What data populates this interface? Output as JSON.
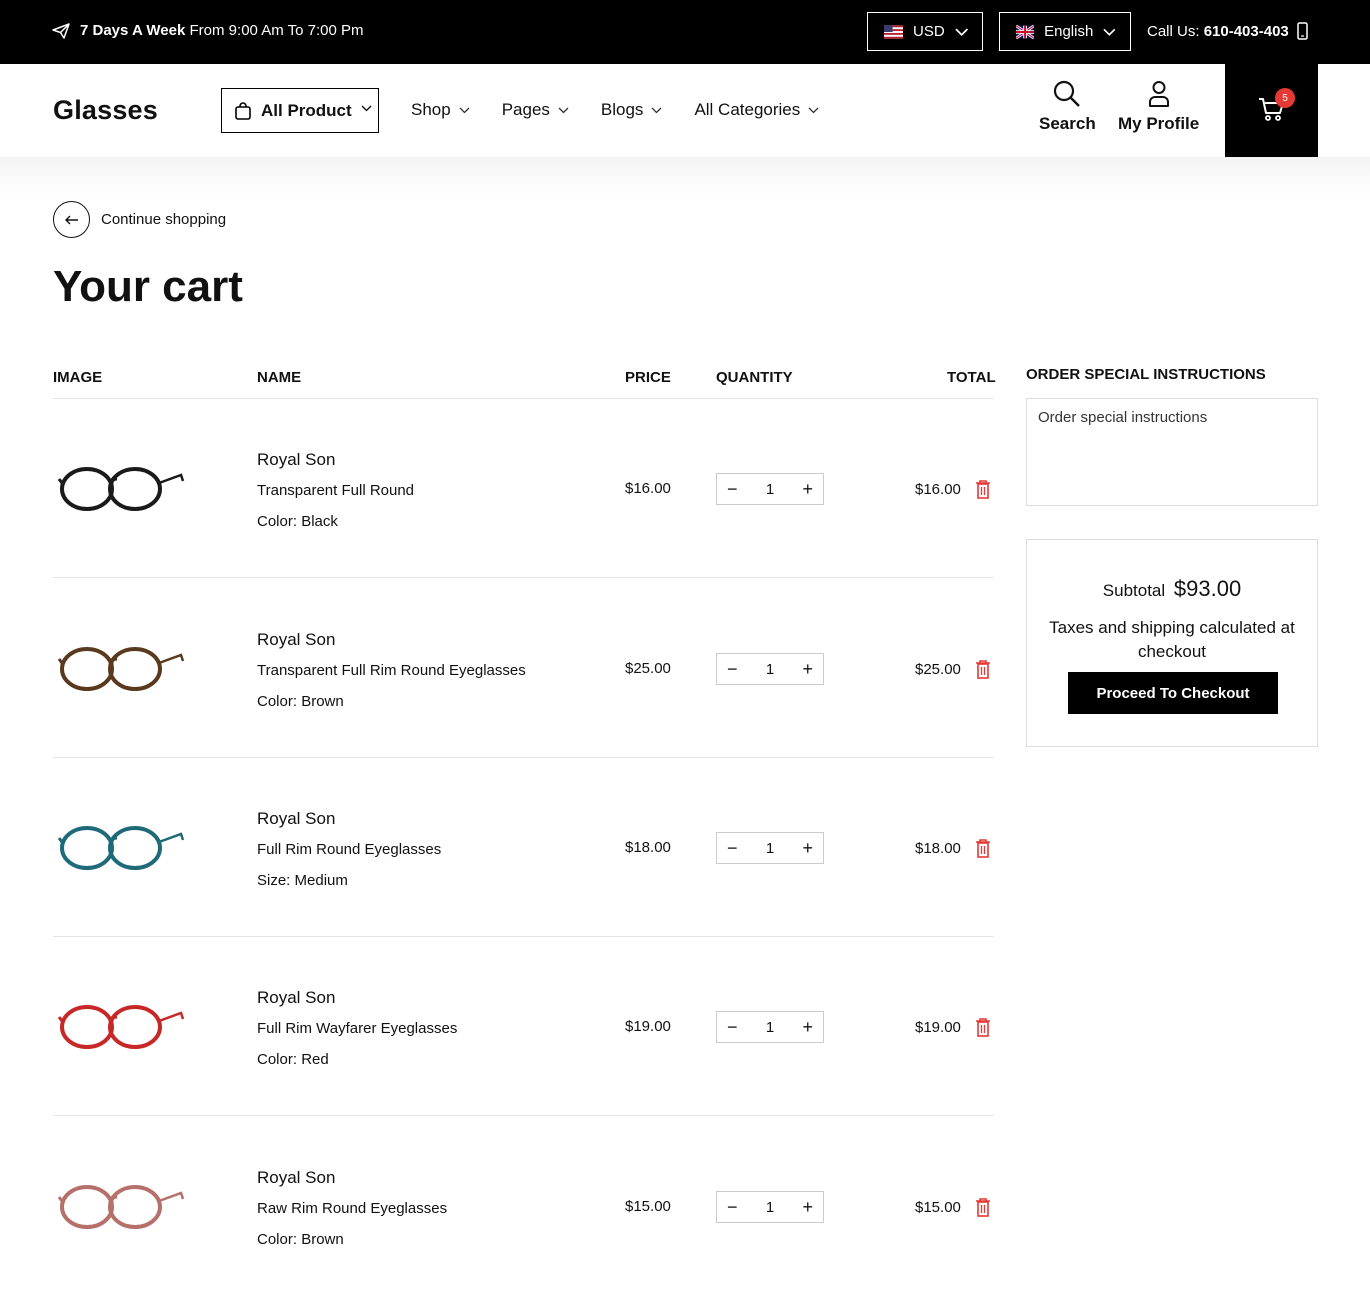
{
  "topbar": {
    "hours_bold": "7 Days A Week",
    "hours_rest": "From 9:00 Am To 7:00 Pm",
    "currency": "USD",
    "language": "English",
    "call_label": "Call Us:",
    "call_number": "610-403-403"
  },
  "header": {
    "logo": "Glasses",
    "all_product": "All Product",
    "nav": [
      "Shop",
      "Pages",
      "Blogs",
      "All Categories"
    ],
    "search_label": "Search",
    "profile_label": "My Profile",
    "cart_count": "5"
  },
  "cart": {
    "continue": "Continue shopping",
    "title": "Your cart",
    "columns": {
      "image": "IMAGE",
      "name": "NAME",
      "price": "PRICE",
      "quantity": "QUANTITY",
      "total": "TOTAL"
    },
    "items": [
      {
        "vendor": "Royal Son",
        "name": "Transparent Full Round",
        "option_label": "Color:",
        "option_value": "Black",
        "price": "$16.00",
        "qty": "1",
        "total": "$16.00",
        "frame_color": "#1a1a1a"
      },
      {
        "vendor": "Royal Son",
        "name": "Transparent Full Rim Round Eyeglasses",
        "option_label": "Color:",
        "option_value": "Brown",
        "price": "$25.00",
        "qty": "1",
        "total": "$25.00",
        "frame_color": "#5a3a1e"
      },
      {
        "vendor": "Royal Son",
        "name": "Full Rim Round Eyeglasses",
        "option_label": "Size:",
        "option_value": "Medium",
        "price": "$18.00",
        "qty": "1",
        "total": "$18.00",
        "frame_color": "#1f6a78"
      },
      {
        "vendor": "Royal Son",
        "name": "Full Rim Wayfarer Eyeglasses",
        "option_label": "Color:",
        "option_value": "Red",
        "price": "$19.00",
        "qty": "1",
        "total": "$19.00",
        "frame_color": "#c62828"
      },
      {
        "vendor": "Royal Son",
        "name": "Raw Rim Round Eyeglasses",
        "option_label": "Color:",
        "option_value": "Brown",
        "price": "$15.00",
        "qty": "1",
        "total": "$15.00",
        "frame_color": "#b5706a"
      }
    ]
  },
  "sidebar": {
    "instructions_title": "ORDER SPECIAL INSTRUCTIONS",
    "instructions_placeholder": "Order special instructions",
    "subtotal_label": "Subtotal",
    "subtotal_value": "$93.00",
    "tax_note": "Taxes and shipping calculated at checkout",
    "checkout": "Proceed To Checkout"
  },
  "colors": {
    "accent": "#000000",
    "trash": "#e53935",
    "badge": "#e53935"
  }
}
